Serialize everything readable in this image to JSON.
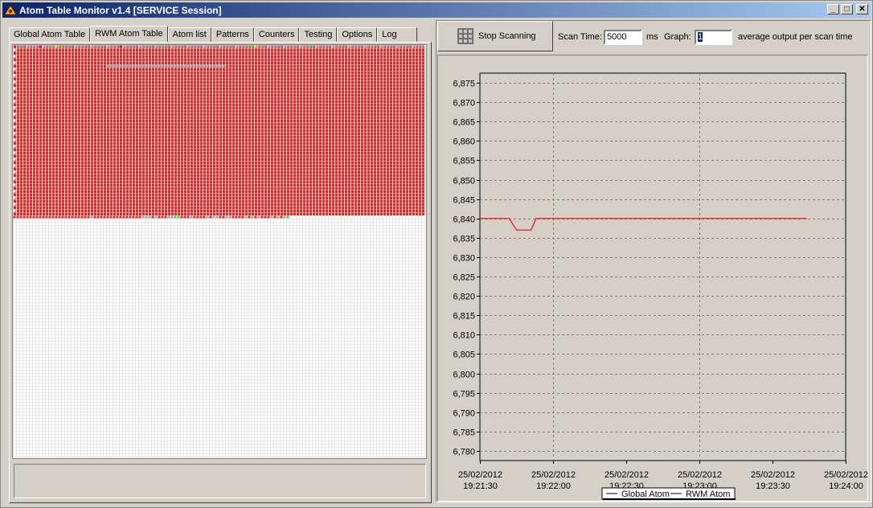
{
  "window": {
    "title": "Atom Table Monitor v1.4 [SERVICE Session]",
    "buttons": {
      "minimize": "_",
      "maximize": "□",
      "close": "✕"
    }
  },
  "tabs": [
    "Global Atom Table",
    "RWM Atom Table",
    "Atom list",
    "Patterns",
    "Counters",
    "Testing",
    "Options",
    "Log"
  ],
  "active_tab": "RWM Atom Table",
  "toolbar": {
    "stop_label": "Stop Scanning",
    "scan_time_label": "Scan Time:",
    "scan_time_value": "5000",
    "scan_time_unit": "ms",
    "graph_label": "Graph:",
    "graph_value": "1",
    "graph_suffix": "average output per scan time"
  },
  "colors": {
    "used": "#d42a2a",
    "free": "#ffffff",
    "grid_line": "#e6e6e6",
    "series_rwm": "#ff0000",
    "series_global": "#000000"
  },
  "chart_data": {
    "type": "line",
    "xlabel": "",
    "ylabel": "",
    "ylim": [
      6777.5,
      6877.5
    ],
    "yticks": [
      "6,875",
      "6,870",
      "6,865",
      "6,860",
      "6,855",
      "6,850",
      "6,845",
      "6,840",
      "6,835",
      "6,830",
      "6,825",
      "6,820",
      "6,815",
      "6,810",
      "6,805",
      "6,800",
      "6,795",
      "6,790",
      "6,785",
      "6,780"
    ],
    "xticks": [
      {
        "date": "25/02/2012",
        "time": "19:21:30"
      },
      {
        "date": "25/02/2012",
        "time": "19:22:00"
      },
      {
        "date": "25/02/2012",
        "time": "19:22:30"
      },
      {
        "date": "25/02/2012",
        "time": "19:23:00"
      },
      {
        "date": "25/02/2012",
        "time": "19:23:30"
      },
      {
        "date": "25/02/2012",
        "time": "19:24:00"
      }
    ],
    "x_range": [
      "19:21:30",
      "19:24:00"
    ],
    "grid": true,
    "legend_position": "bottom",
    "series": [
      {
        "name": "Global Atom",
        "x": [],
        "values": []
      },
      {
        "name": "RWM Atom",
        "x": [
          "19:21:30",
          "19:21:42",
          "19:21:45",
          "19:21:48",
          "19:21:51",
          "19:21:53",
          "19:23:44"
        ],
        "values": [
          6840,
          6840,
          6837,
          6837,
          6837,
          6840,
          6840
        ]
      }
    ]
  }
}
